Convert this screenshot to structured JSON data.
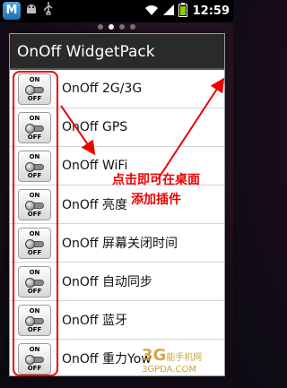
{
  "statusbar": {
    "clock": "12:59",
    "app_badge": "M",
    "left_icons": [
      "android-icon",
      "usb-icon"
    ],
    "right_icons": [
      "wifi-icon",
      "signal-icon",
      "battery-icon"
    ]
  },
  "page_indicator": {
    "count": 4,
    "active_index": 1
  },
  "dialog": {
    "title": "OnOff WidgetPack",
    "items": [
      {
        "label": "OnOff 2G/3G",
        "toggle_on": "ON",
        "toggle_off": "OFF"
      },
      {
        "label": "OnOff GPS",
        "toggle_on": "ON",
        "toggle_off": "OFF"
      },
      {
        "label": "OnOff WiFi",
        "toggle_on": "ON",
        "toggle_off": "OFF"
      },
      {
        "label": "OnOff 亮度",
        "toggle_on": "ON",
        "toggle_off": "OFF"
      },
      {
        "label": "OnOff 屏幕关闭时间",
        "toggle_on": "ON",
        "toggle_off": "OFF"
      },
      {
        "label": "OnOff 自动同步",
        "toggle_on": "ON",
        "toggle_off": "OFF"
      },
      {
        "label": "OnOff 蓝牙",
        "toggle_on": "ON",
        "toggle_off": "OFF"
      },
      {
        "label": "OnOff 重力Yow",
        "toggle_on": "ON",
        "toggle_off": "OFF"
      }
    ]
  },
  "annotation": {
    "text": "点击即可在桌面添加插件",
    "color": "#e00000"
  },
  "watermark": {
    "brand": "3G",
    "name": "能手机网",
    "url": "3GPDA.COM"
  }
}
